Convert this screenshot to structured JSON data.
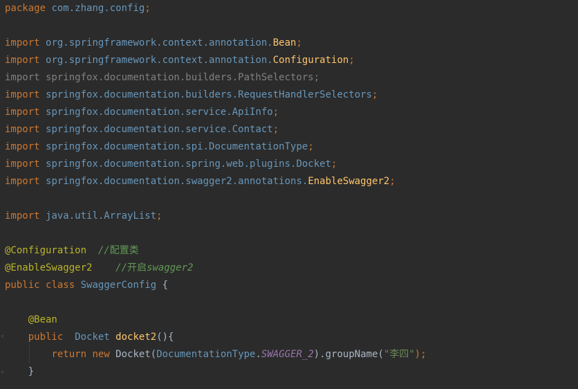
{
  "lines": [
    {
      "segments": [
        {
          "t": "package",
          "c": "kw"
        },
        {
          "t": " ",
          "c": ""
        },
        {
          "t": "com.zhang.config",
          "c": "pkg"
        },
        {
          "t": ";",
          "c": "kw"
        }
      ]
    },
    {
      "segments": []
    },
    {
      "segments": [
        {
          "t": "import",
          "c": "kw"
        },
        {
          "t": " ",
          "c": ""
        },
        {
          "t": "org.springframework.context.annotation.",
          "c": "pkg"
        },
        {
          "t": "Bean",
          "c": "cls"
        },
        {
          "t": ";",
          "c": "kw"
        }
      ]
    },
    {
      "segments": [
        {
          "t": "import",
          "c": "kw"
        },
        {
          "t": " ",
          "c": ""
        },
        {
          "t": "org.springframework.context.annotation.",
          "c": "pkg"
        },
        {
          "t": "Configuration",
          "c": "cls"
        },
        {
          "t": ";",
          "c": "kw"
        }
      ]
    },
    {
      "segments": [
        {
          "t": "import springfox.documentation.builders.PathSelectors;",
          "c": "dim"
        }
      ]
    },
    {
      "segments": [
        {
          "t": "import",
          "c": "kw"
        },
        {
          "t": " ",
          "c": ""
        },
        {
          "t": "springfox.documentation.builders.RequestHandlerSelectors",
          "c": "pkg"
        },
        {
          "t": ";",
          "c": "kw"
        }
      ]
    },
    {
      "segments": [
        {
          "t": "import",
          "c": "kw"
        },
        {
          "t": " ",
          "c": ""
        },
        {
          "t": "springfox.documentation.service.ApiInfo",
          "c": "pkg"
        },
        {
          "t": ";",
          "c": "kw"
        }
      ]
    },
    {
      "segments": [
        {
          "t": "import",
          "c": "kw"
        },
        {
          "t": " ",
          "c": ""
        },
        {
          "t": "springfox.documentation.service.Contact",
          "c": "pkg"
        },
        {
          "t": ";",
          "c": "kw"
        }
      ]
    },
    {
      "segments": [
        {
          "t": "import",
          "c": "kw"
        },
        {
          "t": " ",
          "c": ""
        },
        {
          "t": "springfox.documentation.spi.DocumentationType",
          "c": "pkg"
        },
        {
          "t": ";",
          "c": "kw"
        }
      ]
    },
    {
      "segments": [
        {
          "t": "import",
          "c": "kw"
        },
        {
          "t": " ",
          "c": ""
        },
        {
          "t": "springfox.documentation.spring.web.plugins.Docket",
          "c": "pkg"
        },
        {
          "t": ";",
          "c": "kw"
        }
      ]
    },
    {
      "segments": [
        {
          "t": "import",
          "c": "kw"
        },
        {
          "t": " ",
          "c": ""
        },
        {
          "t": "springfox.documentation.swagger2.annotations.",
          "c": "pkg"
        },
        {
          "t": "EnableSwagger2",
          "c": "cls"
        },
        {
          "t": ";",
          "c": "kw"
        }
      ]
    },
    {
      "segments": []
    },
    {
      "segments": [
        {
          "t": "import",
          "c": "kw"
        },
        {
          "t": " ",
          "c": ""
        },
        {
          "t": "java.util.ArrayList",
          "c": "pkg"
        },
        {
          "t": ";",
          "c": "kw"
        }
      ]
    },
    {
      "segments": []
    },
    {
      "segments": [
        {
          "t": "@Configuration",
          "c": "ann"
        },
        {
          "t": "  ",
          "c": ""
        },
        {
          "t": "//",
          "c": "cmt"
        },
        {
          "t": "配置类",
          "c": "cmt-cn"
        }
      ]
    },
    {
      "segments": [
        {
          "t": "@EnableSwagger2",
          "c": "ann"
        },
        {
          "t": "    ",
          "c": ""
        },
        {
          "t": "//",
          "c": "cmt"
        },
        {
          "t": "开启",
          "c": "cmt-cn"
        },
        {
          "t": "swagger2",
          "c": "cmt"
        }
      ]
    },
    {
      "segments": [
        {
          "t": "public",
          "c": "kw"
        },
        {
          "t": " ",
          "c": ""
        },
        {
          "t": "class",
          "c": "kw"
        },
        {
          "t": " ",
          "c": ""
        },
        {
          "t": "SwaggerConfig",
          "c": "type"
        },
        {
          "t": " {",
          "c": ""
        }
      ]
    },
    {
      "segments": []
    },
    {
      "segments": [
        {
          "t": "    ",
          "c": ""
        },
        {
          "t": "@Bean",
          "c": "ann"
        }
      ]
    },
    {
      "segments": [
        {
          "t": "    ",
          "c": ""
        },
        {
          "t": "public",
          "c": "kw"
        },
        {
          "t": "  ",
          "c": ""
        },
        {
          "t": "Docket",
          "c": "type"
        },
        {
          "t": " ",
          "c": ""
        },
        {
          "t": "docket2",
          "c": "cls"
        },
        {
          "t": "(){",
          "c": ""
        }
      ]
    },
    {
      "segments": [
        {
          "t": "        ",
          "c": ""
        },
        {
          "t": "return",
          "c": "kw"
        },
        {
          "t": " ",
          "c": ""
        },
        {
          "t": "new",
          "c": "kw"
        },
        {
          "t": " Docket(",
          "c": ""
        },
        {
          "t": "DocumentationType",
          "c": "type"
        },
        {
          "t": ".",
          "c": ""
        },
        {
          "t": "SWAGGER_2",
          "c": "const"
        },
        {
          "t": ").groupName(",
          "c": ""
        },
        {
          "t": "\"李四\"",
          "c": "str"
        },
        {
          "t": ");",
          "c": "kw"
        }
      ]
    },
    {
      "segments": [
        {
          "t": "    }",
          "c": ""
        }
      ]
    }
  ],
  "colors": {
    "background": "#2b2b2b",
    "keyword": "#cc7832",
    "annotation": "#bbb529",
    "comment": "#629755",
    "string": "#6a8759"
  }
}
